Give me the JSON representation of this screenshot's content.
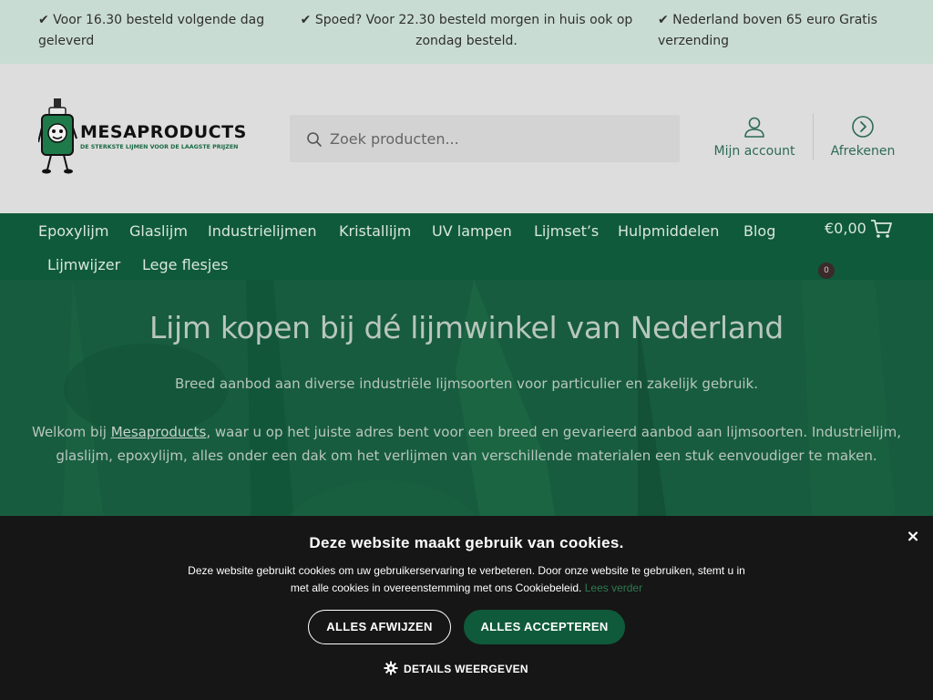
{
  "usp_bar": {
    "items": [
      "✔ Voor 16.30 besteld volgende dag geleverd",
      "✔ Spoed? Voor 22.30 besteld morgen in huis ook op zondag besteld.",
      "✔ Nederland boven 65 euro Gratis verzending"
    ]
  },
  "header": {
    "logo_title": "MESAPRODUCTS",
    "logo_subtitle": "DE STERKSTE LIJMEN VOOR DE LAAGSTE PRIJZEN",
    "search_placeholder": "Zoek producten...",
    "account_label": "Mijn account",
    "checkout_label": "Afrekenen",
    "icons": {
      "search": "search-icon",
      "account": "user-icon",
      "checkout": "arrow-circle-icon",
      "cart": "cart-icon"
    }
  },
  "nav": {
    "items": [
      "Epoxylijm",
      "Glaslijm",
      "Industrielijmen",
      "Kristallijm",
      "UV lampen",
      "Lijmset’s",
      "Hulpmiddelen",
      "Blog",
      "Lijmwijzer",
      "Lege flesjes"
    ],
    "cart_total": "€0,00",
    "cart_count": "0"
  },
  "hero": {
    "title": "Lijm kopen bij dé lijmwinkel van Nederland",
    "lead": "Breed aanbod aan diverse industriële lijmsoorten voor particulier en zakelijk gebruik.",
    "para_before": "Welkom bij ",
    "para_link": "Mesaproducts",
    "para_after": ", waar u op het juiste adres bent voor een breed en gevarieerd aanbod aan lijmsoorten. Industrielijm, glaslijm, epoxylijm, alles onder een dak om het verlijmen van verschillende materialen een stuk eenvoudiger te maken."
  },
  "cookie": {
    "title": "Deze website maakt gebruik van cookies.",
    "text": "Deze website gebruikt cookies om uw gebruikerservaring te verbeteren. Door onze website te gebruiken, stemt u in met alle cookies in overeenstemming met ons Cookiebeleid.",
    "read_more": "Lees verder",
    "reject_label": "ALLES AFWIJZEN",
    "accept_label": "ALLES ACCEPTEREN",
    "details_label": "DETAILS WEERGEVEN",
    "close_label": "×"
  },
  "colors": {
    "usp_bg": "#c9dcd3",
    "header_bg": "#dddddd",
    "brand_green": "#0f5a3a",
    "cookie_bg": "#161616"
  }
}
